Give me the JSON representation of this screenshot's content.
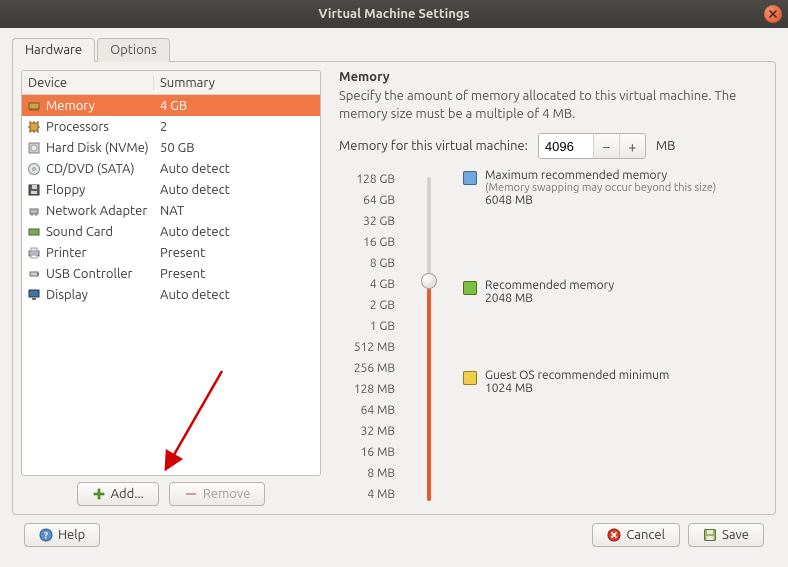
{
  "title": "Virtual Machine Settings",
  "tabs": {
    "hardware": "Hardware",
    "options": "Options"
  },
  "table": {
    "head_device": "Device",
    "head_summary": "Summary",
    "rows": [
      {
        "icon": "memory-icon",
        "name": "Memory",
        "summary": "4 GB",
        "selected": true
      },
      {
        "icon": "cpu-icon",
        "name": "Processors",
        "summary": "2"
      },
      {
        "icon": "disk-icon",
        "name": "Hard Disk (NVMe)",
        "summary": "50 GB"
      },
      {
        "icon": "cd-icon",
        "name": "CD/DVD (SATA)",
        "summary": "Auto detect"
      },
      {
        "icon": "floppy-icon",
        "name": "Floppy",
        "summary": "Auto detect"
      },
      {
        "icon": "network-icon",
        "name": "Network Adapter",
        "summary": "NAT"
      },
      {
        "icon": "sound-icon",
        "name": "Sound Card",
        "summary": "Auto detect"
      },
      {
        "icon": "printer-icon",
        "name": "Printer",
        "summary": "Present"
      },
      {
        "icon": "usb-icon",
        "name": "USB Controller",
        "summary": "Present"
      },
      {
        "icon": "display-icon",
        "name": "Display",
        "summary": "Auto detect"
      }
    ]
  },
  "buttons": {
    "add": "Add...",
    "remove": "Remove",
    "help": "Help",
    "cancel": "Cancel",
    "save": "Save"
  },
  "memory": {
    "title": "Memory",
    "desc": "Specify the amount of memory allocated to this virtual machine. The memory size must be a multiple of 4 MB.",
    "label": "Memory for this virtual machine:",
    "value": "4096",
    "unit": "MB",
    "ticks": [
      "128 GB",
      "64 GB",
      "32 GB",
      "16 GB",
      "8 GB",
      "4 GB",
      "2 GB",
      "1 GB",
      "512 MB",
      "256 MB",
      "128 MB",
      "64 MB",
      "32 MB",
      "16 MB",
      "8 MB",
      "4 MB"
    ],
    "legend": {
      "max": {
        "color": "#6fa8dc",
        "title": "Maximum recommended memory",
        "sub": "(Memory swapping may occur beyond this size)",
        "value": "6048 MB"
      },
      "rec": {
        "color": "#7bc043",
        "title": "Recommended memory",
        "value": "2048 MB"
      },
      "min": {
        "color": "#f2cf4a",
        "title": "Guest OS recommended minimum",
        "value": "1024 MB"
      }
    }
  }
}
